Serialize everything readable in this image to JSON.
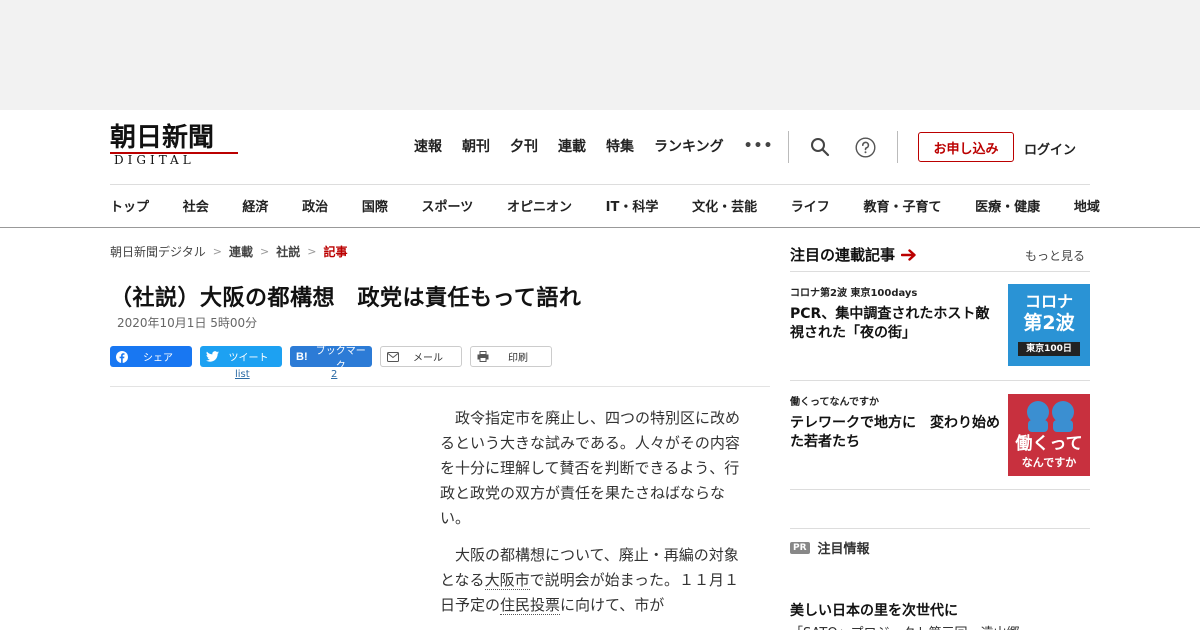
{
  "logo": {
    "main": "朝日新聞",
    "sub": "DIGITAL"
  },
  "topnav": [
    "速報",
    "朝刊",
    "夕刊",
    "連載",
    "特集",
    "ランキング"
  ],
  "more_dots": "•••",
  "signup": "お申し込み",
  "login": "ログイン",
  "categories": [
    "トップ",
    "社会",
    "経済",
    "政治",
    "国際",
    "スポーツ",
    "オピニオン",
    "IT・科学",
    "文化・芸能",
    "ライフ",
    "教育・子育て",
    "医療・健康",
    "地域"
  ],
  "breadcrumb": [
    "朝日新聞デジタル",
    "連載",
    "社説",
    "記事"
  ],
  "article": {
    "title": "（社説）大阪の都構想　政党は責任もって語れ",
    "date": "2020年10月1日 5時00分",
    "para1": "政令指定市を廃止し、四つの特別区に改めるという大きな試みである。人々がその内容を十分に理解して賛否を判断できるよう、行政と政党の双方が責任を果たさねばならない。",
    "para2_a": "大阪の都構想について、廃止・再編の対象となる",
    "para2_kw1": "大阪市",
    "para2_b": "で説明会が始まった。１１月１日予定の",
    "para2_kw2": "住民投票",
    "para2_c": "に向けて、市が"
  },
  "share": {
    "facebook": "シェア",
    "twitter": "ツイート",
    "hatena": "ブックマーク",
    "mail": "メール",
    "print": "印刷",
    "twitter_count": "list",
    "hatena_count": "2"
  },
  "sidebar": {
    "heading": "注目の連載記事",
    "more": "もっと見る",
    "cards": [
      {
        "tag": "コロナ第2波 東京100days",
        "title": "PCR、集中調査されたホスト敵視された「夜の街」",
        "thumb_line1": "コロナ",
        "thumb_line2": "第2波",
        "thumb_line3": "東京100日"
      },
      {
        "tag": "働くってなんですか",
        "title": "テレワークで地方に　変わり始めた若者たち",
        "thumb_line1": "働くって",
        "thumb_line2": "なんですか"
      }
    ],
    "pr_badge": "PR",
    "pr_label": "注目情報",
    "pr_title": "美しい日本の里を次世代に",
    "pr_sub": "「SATO」プロジェクト第三回　遠山郷"
  },
  "colors": {
    "accent": "#b00000",
    "facebook": "#1877f2",
    "twitter": "#1da1f2",
    "hatena": "#2c7bd6"
  }
}
